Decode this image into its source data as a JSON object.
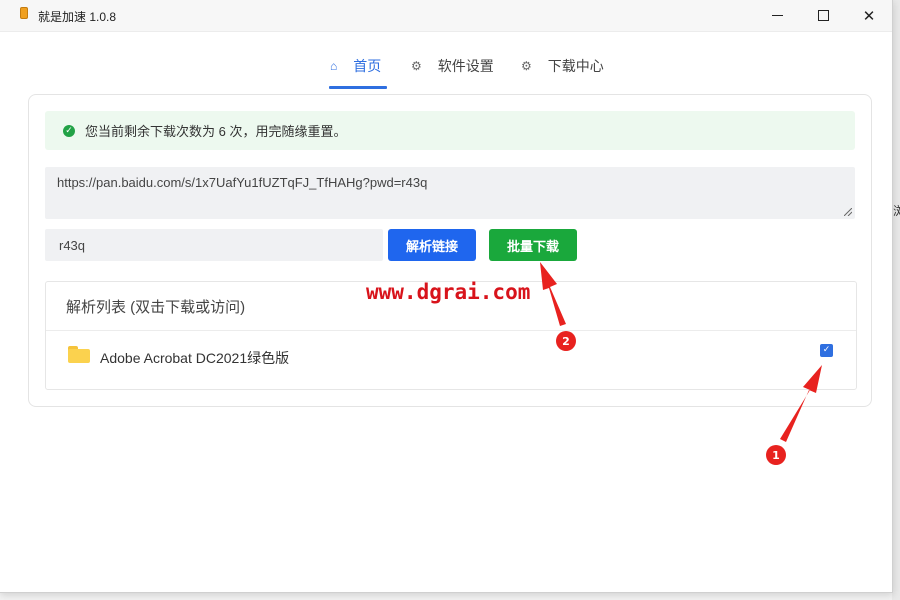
{
  "window": {
    "title": "就是加速  1.0.8",
    "controls": {
      "minimize": "minimize-icon",
      "maximize": "maximize-icon",
      "close": "close-icon"
    }
  },
  "tabs": [
    {
      "label": "首页",
      "icon": "home-icon",
      "active": true
    },
    {
      "label": "软件设置",
      "icon": "gear-icon",
      "active": false
    },
    {
      "label": "下载中心",
      "icon": "gear-icon",
      "active": false
    }
  ],
  "alert": {
    "text": "您当前剩余下载次数为 6 次，用完随缘重置。",
    "icon": "check-circle-icon",
    "color": "#22a246"
  },
  "form": {
    "url_value": "https://pan.baidu.com/s/1x7UafYu1fUZTqFJ_TfHAHg?pwd=r43q",
    "password_value": "r43q",
    "parse_button": "解析链接",
    "batch_button": "批量下载"
  },
  "list": {
    "header": "解析列表 (双击下载或访问)",
    "items": [
      {
        "name": "Adobe Acrobat DC2021绿色版",
        "icon": "folder-icon",
        "checked": true
      }
    ]
  },
  "annotations": {
    "watermark": "www.dgrai.com",
    "markers": [
      "1",
      "2"
    ],
    "color": "#e8221f"
  },
  "colors": {
    "accent": "#2f6fe0",
    "parse_button": "#1f66ee",
    "batch_button": "#1aa83c",
    "alert_bg": "#edf9ef"
  }
}
